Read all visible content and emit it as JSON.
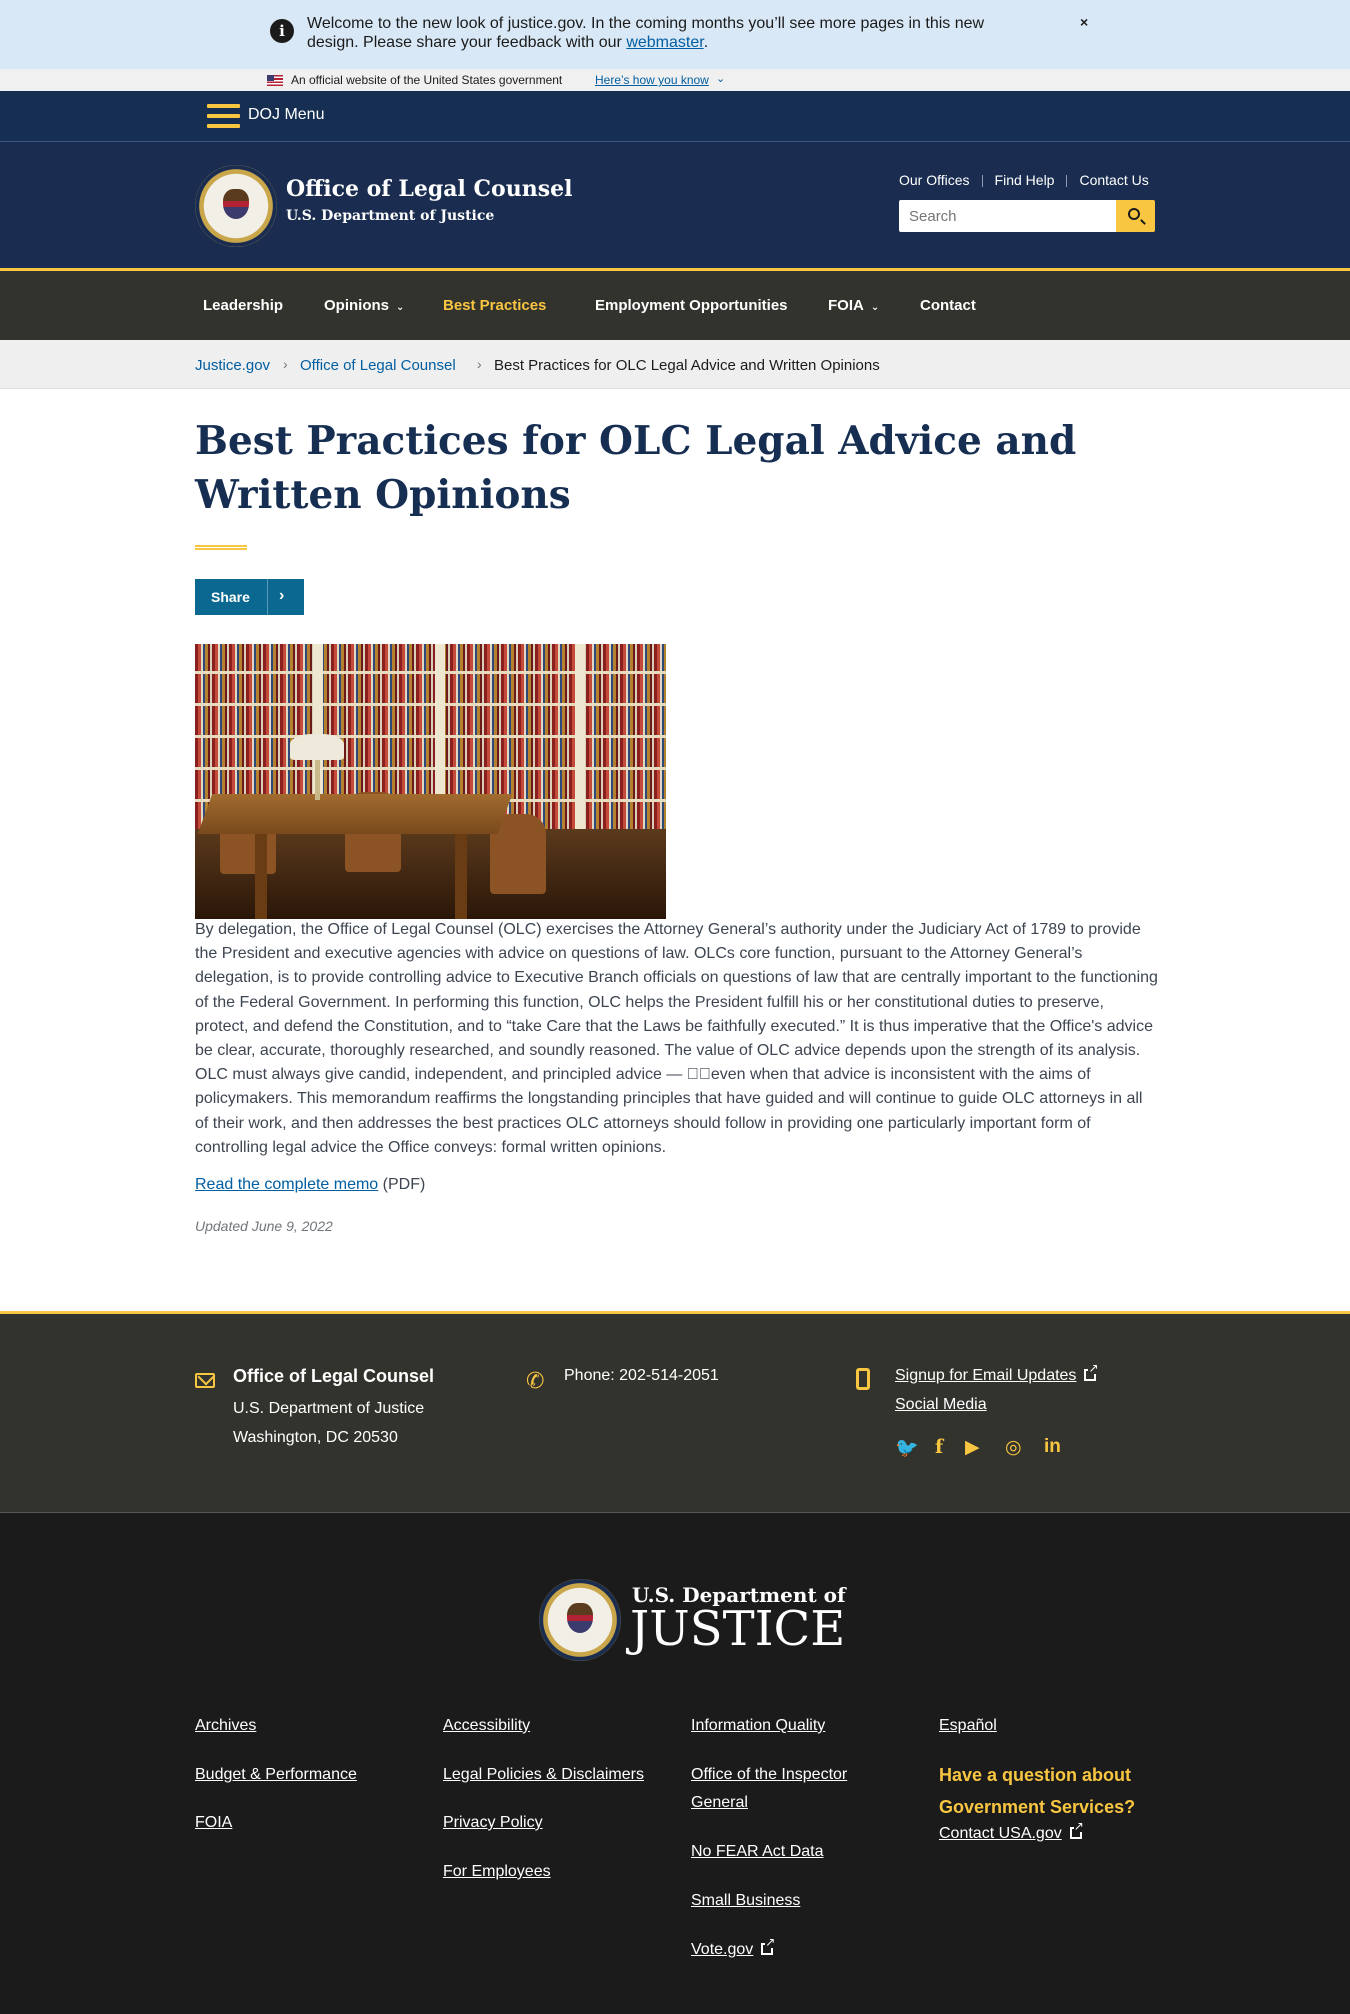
{
  "alert": {
    "message": "Welcome to the new look of justice.gov. In the coming months you’ll see more pages in this new design. Please share your feedback with our",
    "link_text": "webmaster",
    "trailing": ".",
    "close_label": "×",
    "icon": "info-icon"
  },
  "gov_banner": {
    "official_text": "An official website of the United States government",
    "how_link": "Here’s how you know",
    "chevron": "⌄"
  },
  "doj_menu": {
    "label": "DOJ Menu"
  },
  "header": {
    "office_name": "Office of Legal Counsel",
    "department": "U.S. Department of Justice",
    "util_links": [
      "Our Offices",
      "Find Help",
      "Contact Us"
    ],
    "search_placeholder": "Search"
  },
  "nav": {
    "items": [
      {
        "label": "Leadership",
        "dropdown": false,
        "current": false
      },
      {
        "label": "Opinions",
        "dropdown": true,
        "current": false
      },
      {
        "label": "Best Practices",
        "dropdown": false,
        "current": true
      },
      {
        "label": "Employment Opportunities",
        "dropdown": false,
        "current": false
      },
      {
        "label": "FOIA",
        "dropdown": true,
        "current": false
      },
      {
        "label": "Contact",
        "dropdown": false,
        "current": false
      }
    ],
    "chevron": "⌄"
  },
  "breadcrumb": {
    "items": [
      "Justice.gov",
      "Office of Legal Counsel"
    ],
    "current": "Best Practices for OLC Legal Advice and Written Opinions",
    "separator": "›"
  },
  "main": {
    "title": "Best Practices for OLC Legal Advice and Written Opinions",
    "share_label": "Share",
    "share_chevron": "›",
    "body": "By delegation, the Office of Legal Counsel (OLC) exercises the Attorney General’s authority under the Judiciary Act of 1789 to provide the President and executive agencies with advice on questions of law.  OLCs core function, pursuant to the Attorney General’s delegation, is to provide controlling advice to Executive Branch officials on questions of law that are centrally important to the functioning of the Federal Government.  In performing this function, OLC helps the President fulfill his or her constitutional duties to preserve, protect, and defend the Constitution, and to “take Care that the Laws be faithfully executed.”  It is thus imperative that the Office's advice be clear, accurate, thoroughly researched, and soundly reasoned.  The value of OLC advice depends upon the strength of its analysis.  OLC must always give candid, independent, and principled advice — \u0000\u0000even when that advice is inconsistent with the aims of policymakers.  This memorandum reaffirms the longstanding principles that have guided and will continue to guide OLC attorneys in all of their work, and then addresses the best practices OLC attorneys should follow in providing one particularly important form of controlling legal advice the Office conveys: formal written opinions.",
    "memo_link": "Read the complete memo",
    "memo_suffix": " (PDF)",
    "updated": "Updated June 9, 2022"
  },
  "footer_contact": {
    "office": "Office of Legal Counsel",
    "dept": "U.S. Department of Justice",
    "city": "Washington, DC 20530",
    "phone": "Phone: 202-514-2051",
    "email_updates": "Signup for Email Updates",
    "social_media": "Social Media",
    "social_icons": [
      "twitter-icon",
      "facebook-icon",
      "youtube-icon",
      "instagram-icon",
      "linkedin-icon"
    ],
    "social_glyphs": [
      "🐦",
      "f",
      "▶",
      "◎",
      "in"
    ]
  },
  "footer": {
    "dept_small": "U.S. Department of",
    "dept_big": "JUSTICE",
    "col1": [
      "Archives",
      "Budget & Performance",
      "FOIA"
    ],
    "col2": [
      "Accessibility",
      "Legal Policies & Disclaimers",
      "Privacy Policy",
      "For Employees"
    ],
    "col3": [
      "Information Quality",
      "Office of the Inspector General",
      "No FEAR Act Data",
      "Small Business",
      "Vote.gov"
    ],
    "col4_link": "Español",
    "question": "Have a question about Government Services?",
    "contact_usa": "Contact USA.gov"
  },
  "colors": {
    "navy": "#162e51",
    "gold": "#f9c642",
    "dark": "#33332e",
    "link": "#005ea2",
    "share": "#0b6891"
  }
}
